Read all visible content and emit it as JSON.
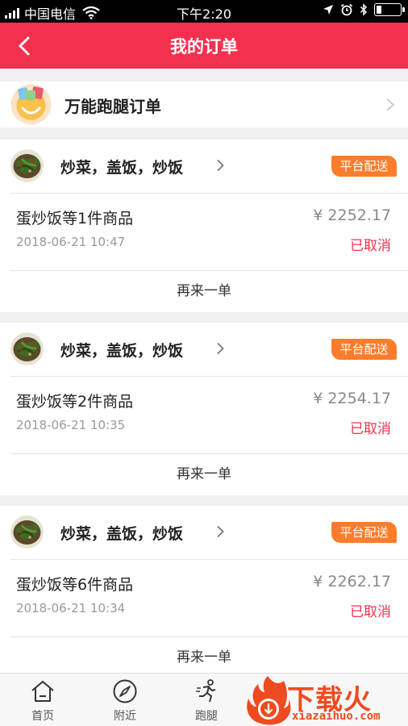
{
  "status_bar": {
    "carrier": "中国电信",
    "time": "下午2:20",
    "battery_level": 0.2
  },
  "nav": {
    "title": "我的订单",
    "back_icon": "chevron-left-icon"
  },
  "runner_order": {
    "label": "万能跑腿订单"
  },
  "orders": [
    {
      "shop_name": "炒菜，盖饭，炒饭",
      "badge": "平台配送",
      "items": "蛋炒饭等1件商品",
      "price": "¥ 2252.17",
      "date": "2018-06-21 10:47",
      "status": "已取消",
      "reorder": "再来一单"
    },
    {
      "shop_name": "炒菜，盖饭，炒饭",
      "badge": "平台配送",
      "items": "蛋炒饭等2件商品",
      "price": "¥ 2254.17",
      "date": "2018-06-21 10:35",
      "status": "已取消",
      "reorder": "再来一单"
    },
    {
      "shop_name": "炒菜，盖饭，炒饭",
      "badge": "平台配送",
      "items": "蛋炒饭等6件商品",
      "price": "¥ 2262.17",
      "date": "2018-06-21 10:34",
      "status": "已取消",
      "reorder": "再来一单"
    }
  ],
  "tabs": [
    {
      "label": "首页",
      "icon": "home-icon"
    },
    {
      "label": "附近",
      "icon": "compass-icon"
    },
    {
      "label": "跑腿",
      "icon": "runner-icon"
    }
  ],
  "watermark": {
    "text": "下载火",
    "url": "xiazaihuo.com"
  },
  "colors": {
    "brand_red": "#f3314e",
    "badge_orange": "#fb7d2b",
    "watermark_orange": "#f04a20"
  }
}
